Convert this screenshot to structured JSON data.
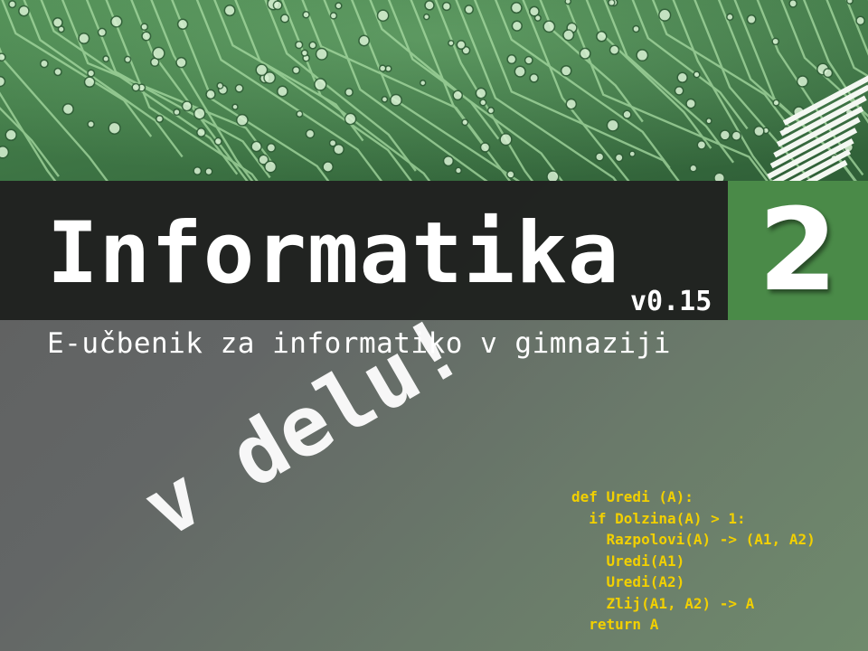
{
  "cover": {
    "title": "Informatika",
    "version": "v0.15",
    "volume_number": "2",
    "subtitle": "E-učbenik za informatiko v gimnaziji",
    "stamp": "v delu!"
  },
  "code_snippet": {
    "lines": [
      "def Uredi (A):",
      "  if Dolzina(A) > 1:",
      "    Razpolovi(A) -> (A1, A2)",
      "    Uredi(A1)",
      "    Uredi(A2)",
      "    Zlij(A1, A2) -> A",
      "  return A"
    ]
  },
  "colors": {
    "circuit_board": "#3f7a45",
    "trace": "#9ed49a",
    "title_band": "#1c1e1c",
    "number_box": "#4a8a48",
    "code_text": "#f2d000",
    "text": "#ffffff"
  }
}
